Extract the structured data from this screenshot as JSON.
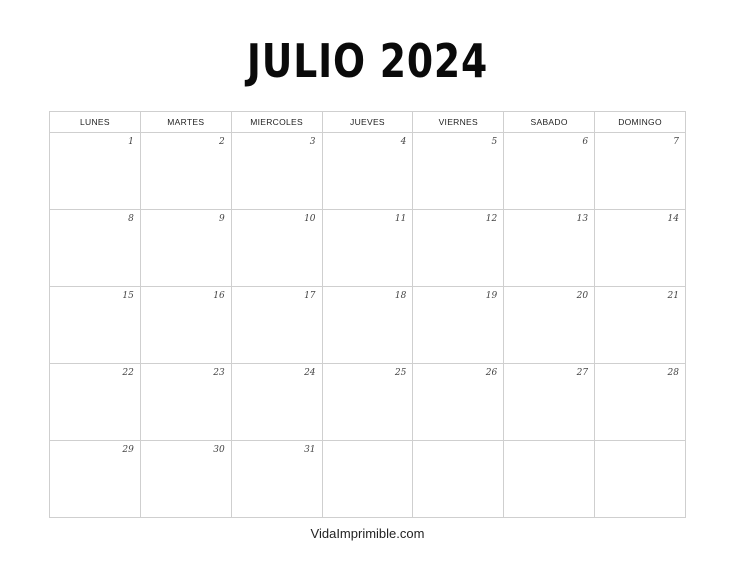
{
  "title": "JULIO 2024",
  "weekdays": [
    "LUNES",
    "MARTES",
    "MIERCOLES",
    "JUEVES",
    "VIERNES",
    "SABADO",
    "DOMINGO"
  ],
  "weeks": [
    [
      "1",
      "2",
      "3",
      "4",
      "5",
      "6",
      "7"
    ],
    [
      "8",
      "9",
      "10",
      "11",
      "12",
      "13",
      "14"
    ],
    [
      "15",
      "16",
      "17",
      "18",
      "19",
      "20",
      "21"
    ],
    [
      "22",
      "23",
      "24",
      "25",
      "26",
      "27",
      "28"
    ],
    [
      "29",
      "30",
      "31",
      "",
      "",
      "",
      ""
    ]
  ],
  "footer": "VidaImprimible.com"
}
